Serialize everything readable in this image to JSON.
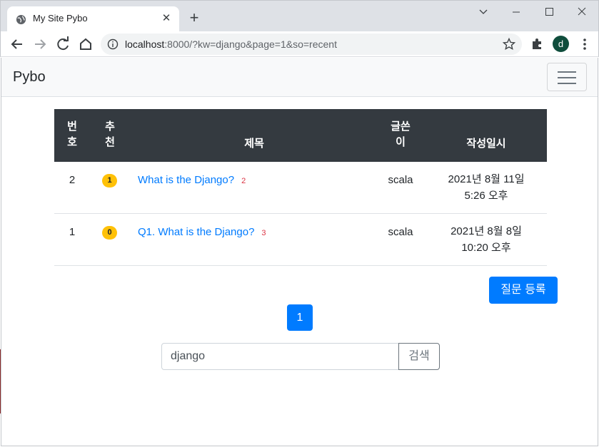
{
  "browser": {
    "tab_title": "My Site Pybo",
    "new_tab_label": "+",
    "url_host": "localhost",
    "url_rest": ":8000/?kw=django&page=1&so=recent",
    "profile_initial": "d"
  },
  "navbar": {
    "brand": "Pybo"
  },
  "table": {
    "headers": {
      "number_1": "번",
      "number_2": "호",
      "vote_1": "추",
      "vote_2": "천",
      "subject": "제목",
      "author_1": "글쓴",
      "author_2": "이",
      "date": "작성일시"
    },
    "rows": [
      {
        "number": "2",
        "votes": "1",
        "subject": "What is the Django?",
        "answers": "2",
        "author": "scala",
        "date_line1": "2021년 8월 11일",
        "date_line2": "5:26 오후"
      },
      {
        "number": "1",
        "votes": "0",
        "subject": "Q1. What is the Django?",
        "answers": "3",
        "author": "scala",
        "date_line1": "2021년 8월 8일",
        "date_line2": "10:20 오후"
      }
    ]
  },
  "register_button": "질문 등록",
  "pagination": {
    "current": "1"
  },
  "search": {
    "value": "django",
    "button": "검색"
  },
  "colors": {
    "primary": "#007bff",
    "dark_header": "#343a40",
    "badge": "#ffc107",
    "answer_count": "#dc3545"
  }
}
